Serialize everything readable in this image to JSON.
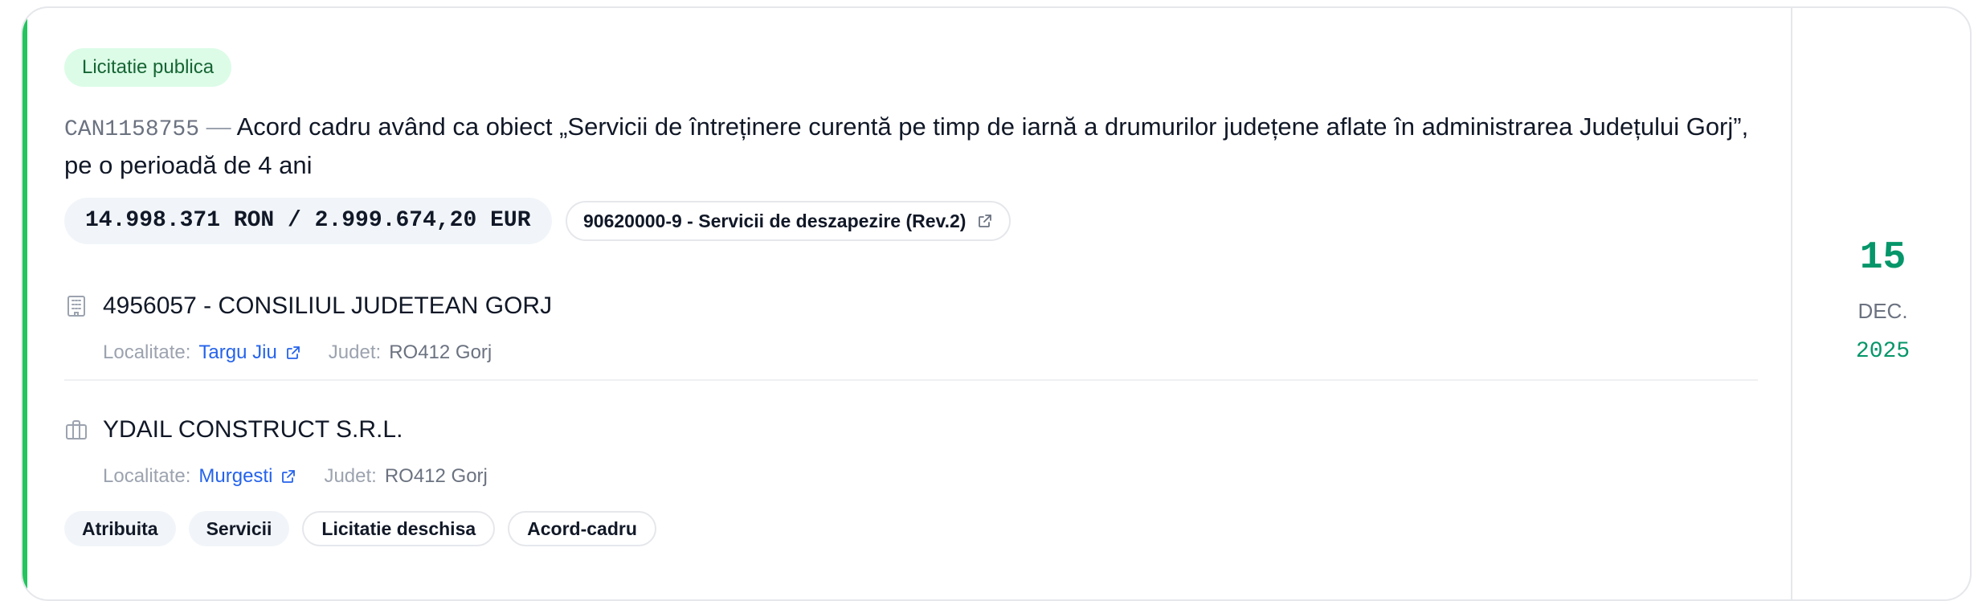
{
  "notice": {
    "procedure_badge": "Licitatie publica",
    "code": "CAN1158755",
    "separator": "—",
    "title": "Acord cadru având ca obiect „Servicii de întreținere curentă pe timp de iarnă a drumurilor județene aflate în administrarea Județului Gorj”, pe o perioadă de 4 ani",
    "value": "14.998.371 RON / 2.999.674,20 EUR",
    "cpv": "90620000-9 - Servicii de deszapezire (Rev.2)"
  },
  "authority": {
    "name": "4956057 - CONSILIUL JUDETEAN GORJ",
    "locality_label": "Localitate:",
    "locality": "Targu Jiu",
    "county_label": "Judet:",
    "county": "RO412 Gorj"
  },
  "supplier": {
    "name": "YDAIL CONSTRUCT S.R.L.",
    "locality_label": "Localitate:",
    "locality": "Murgesti",
    "county_label": "Judet:",
    "county": "RO412 Gorj"
  },
  "tags": [
    "Atribuita",
    "Servicii",
    "Licitatie deschisa",
    "Acord-cadru"
  ],
  "date": {
    "day": "15",
    "month": "DEC.",
    "year": "2025"
  },
  "colors": {
    "accent": "#22c55e",
    "date": "#059669",
    "link": "#2563eb",
    "badge_bg": "#dcfce7"
  },
  "icons": {
    "authority": "building-icon",
    "supplier": "briefcase-icon",
    "external": "external-link-icon"
  }
}
